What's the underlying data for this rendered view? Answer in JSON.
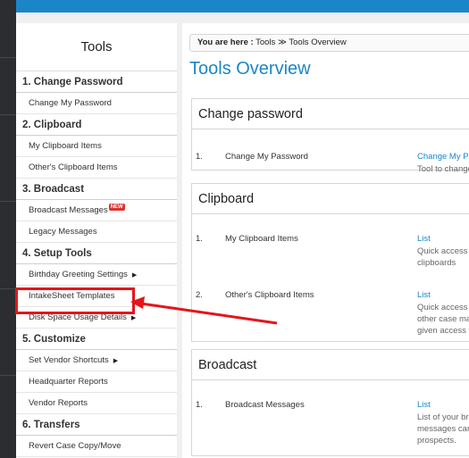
{
  "sidebar": {
    "title": "Tools",
    "sections": [
      {
        "label": "1. Change Password",
        "items": [
          {
            "label": "Change My Password",
            "has_submenu": false,
            "badge": ""
          }
        ]
      },
      {
        "label": "2. Clipboard",
        "items": [
          {
            "label": "My Clipboard Items",
            "has_submenu": false,
            "badge": ""
          },
          {
            "label": "Other's Clipboard Items",
            "has_submenu": false,
            "badge": ""
          }
        ]
      },
      {
        "label": "3. Broadcast",
        "items": [
          {
            "label": "Broadcast Messages",
            "has_submenu": false,
            "badge": "NEW"
          },
          {
            "label": "Legacy Messages",
            "has_submenu": false,
            "badge": ""
          }
        ]
      },
      {
        "label": "4. Setup Tools",
        "items": [
          {
            "label": "Birthday Greeting Settings",
            "has_submenu": true,
            "badge": ""
          },
          {
            "label": "IntakeSheet Templates",
            "has_submenu": false,
            "badge": "",
            "highlighted": true
          },
          {
            "label": "Disk Space Usage Details",
            "has_submenu": true,
            "badge": ""
          }
        ]
      },
      {
        "label": "5. Customize",
        "items": [
          {
            "label": "Set Vendor Shortcuts",
            "has_submenu": true,
            "badge": ""
          },
          {
            "label": "Headquarter Reports",
            "has_submenu": false,
            "badge": ""
          },
          {
            "label": "Vendor Reports",
            "has_submenu": false,
            "badge": ""
          }
        ]
      },
      {
        "label": "6. Transfers",
        "items": [
          {
            "label": "Revert Case Copy/Move",
            "has_submenu": false,
            "badge": ""
          }
        ]
      }
    ]
  },
  "breadcrumb": {
    "lead": "You are here :",
    "items": [
      "Tools",
      "Tools Overview"
    ],
    "separator": "≫"
  },
  "main": {
    "title": "Tools Overview",
    "panels": [
      {
        "heading": "Change password",
        "rows": [
          {
            "num": "1.",
            "name": "Change My Password",
            "link": "Change My P",
            "desc": [
              "Tool to change"
            ]
          }
        ]
      },
      {
        "heading": "Clipboard",
        "rows": [
          {
            "num": "1.",
            "name": "My Clipboard Items",
            "link": "List",
            "desc": [
              "Quick access",
              "clipboards"
            ]
          },
          {
            "num": "2.",
            "name": "Other's Clipboard Items",
            "link": "List",
            "desc": [
              "Quick access",
              "other case ma",
              "given access t"
            ]
          }
        ]
      },
      {
        "heading": "Broadcast",
        "rows": [
          {
            "num": "1.",
            "name": "Broadcast Messages",
            "link": "List",
            "desc": [
              "List of your bro",
              "messages car",
              "prospects."
            ]
          }
        ]
      }
    ]
  },
  "colors": {
    "topbar": "#1a86c7",
    "link": "#1a86c7",
    "highlight": "#e4151b",
    "dark_strip": "#2b2d31"
  }
}
